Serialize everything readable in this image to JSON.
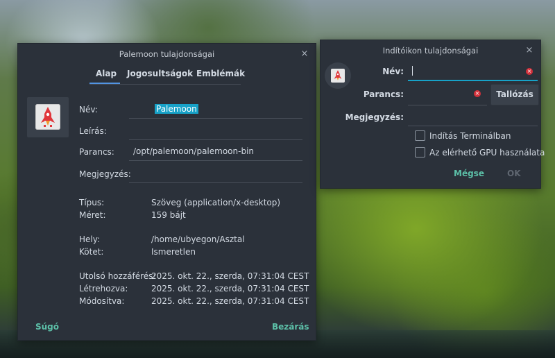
{
  "properties_window": {
    "title": "Palemoon tulajdonságai",
    "tabs": [
      "Alap",
      "Jogosultságok",
      "Emblémák"
    ],
    "active_tab": "Alap",
    "fields": {
      "name_label": "Név:",
      "name_value": "Palemoon",
      "description_label": "Leírás:",
      "description_value": "",
      "command_label": "Parancs:",
      "command_value": "/opt/palemoon/palemoon-bin",
      "comment_label": "Megjegyzés:",
      "comment_value": ""
    },
    "info": {
      "type_label": "Típus:",
      "type_value": "Szöveg (application/x-desktop)",
      "size_label": "Méret:",
      "size_value": "159 bájt",
      "location_label": "Hely:",
      "location_value": "/home/ubyegon/Asztal",
      "volume_label": "Kötet:",
      "volume_value": "Ismeretlen",
      "accessed_label": "Utolsó hozzáférés:",
      "accessed_value": "2025. okt. 22., szerda, 07:31:04 CEST",
      "created_label": "Létrehozva:",
      "created_value": "2025. okt. 22., szerda, 07:31:04 CEST",
      "modified_label": "Módosítva:",
      "modified_value": "2025. okt. 22., szerda, 07:31:04 CEST"
    },
    "help_button": "Súgó",
    "close_button": "Bezárás",
    "close_icon": "×"
  },
  "launcher_window": {
    "title": "Indítóikon tulajdonságai",
    "close_icon": "×",
    "name_label": "Név:",
    "name_value": "",
    "command_label": "Parancs:",
    "command_value": "",
    "browse_button": "Tallózás",
    "comment_label": "Megjegyzés:",
    "comment_value": "",
    "run_in_terminal": "Indítás Terminálban",
    "use_gpu": "Az elérhető GPU használata",
    "run_in_terminal_checked": false,
    "use_gpu_checked": false,
    "cancel_button": "Mégse",
    "ok_button": "OK"
  },
  "colors": {
    "dialog_bg": "#2b313a",
    "accent_link": "#5cc0a8",
    "selection": "#17a2c8",
    "tab_underline": "#5294e2",
    "clear_icon": "#d3303a"
  },
  "icons": {
    "app_icon": "rocket-icon",
    "clear_icon": "clear-icon",
    "close_icon": "close-icon"
  }
}
